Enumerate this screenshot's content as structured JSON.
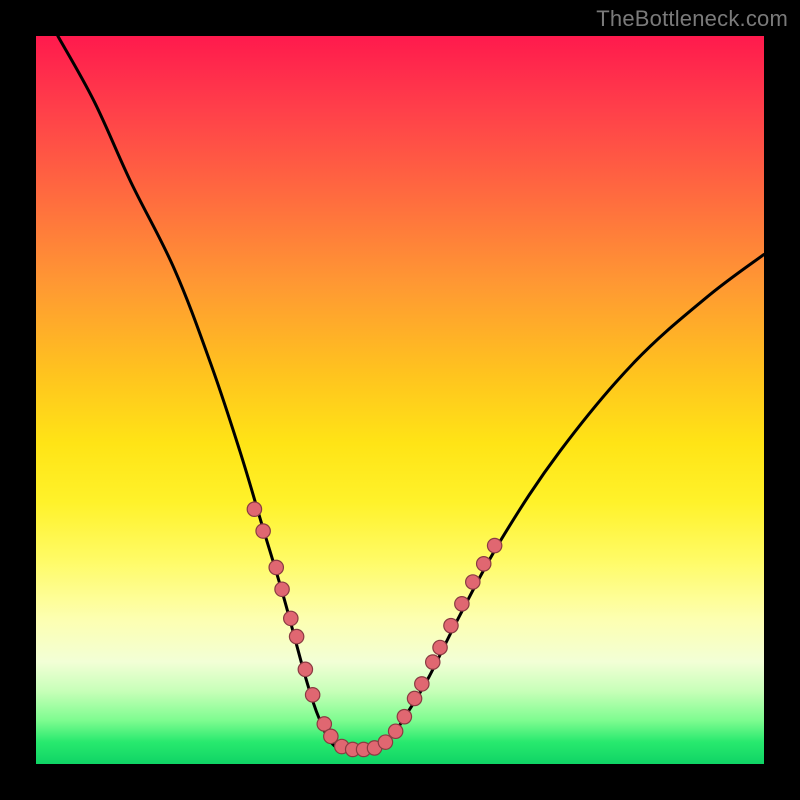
{
  "watermark": "TheBottleneck.com",
  "colors": {
    "frame": "#000000",
    "watermark": "#7a7a7a",
    "curve": "#000000",
    "dot_fill": "#e06771",
    "dot_stroke": "#8a3b42",
    "gradient_stops": [
      "#ff1a4d",
      "#ff3f4a",
      "#ff6b3f",
      "#ff9833",
      "#ffc21f",
      "#ffe416",
      "#fff22a",
      "#fffb66",
      "#fdffb0",
      "#f2ffd6",
      "#c7ffb8",
      "#7efc90",
      "#28e96e",
      "#0fd465"
    ]
  },
  "chart_data": {
    "type": "line",
    "title": "",
    "xlabel": "",
    "ylabel": "",
    "xlim": [
      0,
      100
    ],
    "ylim": [
      0,
      100
    ],
    "grid": false,
    "legend": false,
    "notes": "Axes have no visible ticks or labels; values are positions in percent of the gradient plot area, origin at bottom-left. Curve drops from top-left, bottoms out near x≈40–48, then rises toward upper-right. Markers cluster along the two steep walls near the valley.",
    "series": [
      {
        "name": "bottleneck-curve",
        "points": [
          {
            "x": 3.0,
            "y": 100.0
          },
          {
            "x": 8.0,
            "y": 91.0
          },
          {
            "x": 13.0,
            "y": 80.0
          },
          {
            "x": 19.0,
            "y": 68.0
          },
          {
            "x": 24.0,
            "y": 55.0
          },
          {
            "x": 28.0,
            "y": 43.0
          },
          {
            "x": 31.0,
            "y": 33.0
          },
          {
            "x": 34.0,
            "y": 23.0
          },
          {
            "x": 37.0,
            "y": 12.0
          },
          {
            "x": 39.0,
            "y": 6.0
          },
          {
            "x": 41.0,
            "y": 2.5
          },
          {
            "x": 44.0,
            "y": 1.8
          },
          {
            "x": 47.0,
            "y": 2.2
          },
          {
            "x": 49.0,
            "y": 4.0
          },
          {
            "x": 51.0,
            "y": 7.0
          },
          {
            "x": 54.0,
            "y": 12.0
          },
          {
            "x": 58.0,
            "y": 20.0
          },
          {
            "x": 64.0,
            "y": 31.0
          },
          {
            "x": 72.0,
            "y": 43.0
          },
          {
            "x": 82.0,
            "y": 55.0
          },
          {
            "x": 92.0,
            "y": 64.0
          },
          {
            "x": 100.0,
            "y": 70.0
          }
        ]
      }
    ],
    "markers": [
      {
        "x": 30.0,
        "y": 35.0
      },
      {
        "x": 31.2,
        "y": 32.0
      },
      {
        "x": 33.0,
        "y": 27.0
      },
      {
        "x": 33.8,
        "y": 24.0
      },
      {
        "x": 35.0,
        "y": 20.0
      },
      {
        "x": 35.8,
        "y": 17.5
      },
      {
        "x": 37.0,
        "y": 13.0
      },
      {
        "x": 38.0,
        "y": 9.5
      },
      {
        "x": 39.6,
        "y": 5.5
      },
      {
        "x": 40.5,
        "y": 3.8
      },
      {
        "x": 42.0,
        "y": 2.4
      },
      {
        "x": 43.5,
        "y": 2.0
      },
      {
        "x": 45.0,
        "y": 2.0
      },
      {
        "x": 46.5,
        "y": 2.2
      },
      {
        "x": 48.0,
        "y": 3.0
      },
      {
        "x": 49.4,
        "y": 4.5
      },
      {
        "x": 50.6,
        "y": 6.5
      },
      {
        "x": 52.0,
        "y": 9.0
      },
      {
        "x": 53.0,
        "y": 11.0
      },
      {
        "x": 54.5,
        "y": 14.0
      },
      {
        "x": 55.5,
        "y": 16.0
      },
      {
        "x": 57.0,
        "y": 19.0
      },
      {
        "x": 58.5,
        "y": 22.0
      },
      {
        "x": 60.0,
        "y": 25.0
      },
      {
        "x": 61.5,
        "y": 27.5
      },
      {
        "x": 63.0,
        "y": 30.0
      }
    ]
  }
}
